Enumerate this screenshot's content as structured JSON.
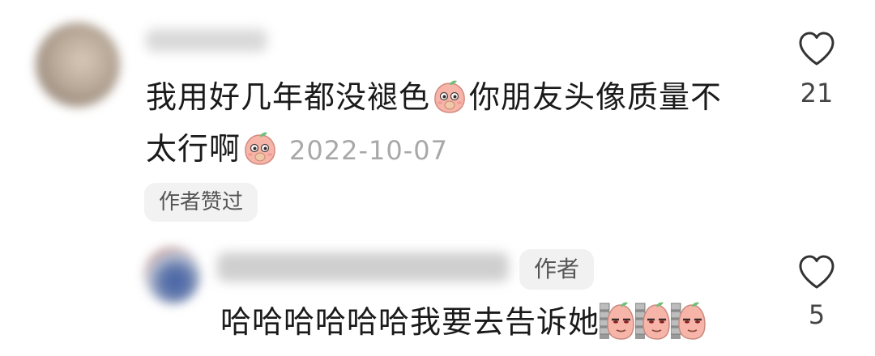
{
  "comment": {
    "line1_text": "我用好几年都没褪色",
    "line1_text_after_emoji": "你朋友头像质量不",
    "line2_text": "太行啊",
    "date": "2022-10-07",
    "badge": "作者赞过",
    "likes": "21",
    "emoji": "peach-face-emoji"
  },
  "reply": {
    "author_tag": "作者",
    "text": "哈哈哈哈哈哈我要去告诉她",
    "likes": "5",
    "emoji": "sneaky-peach-emoji"
  },
  "icons": {
    "like": "heart-outline-icon"
  },
  "colors": {
    "text": "#1a1a1a",
    "muted": "#a8a8a8",
    "chip_bg": "#f2f2f2",
    "peach": "#f6b5a8"
  }
}
